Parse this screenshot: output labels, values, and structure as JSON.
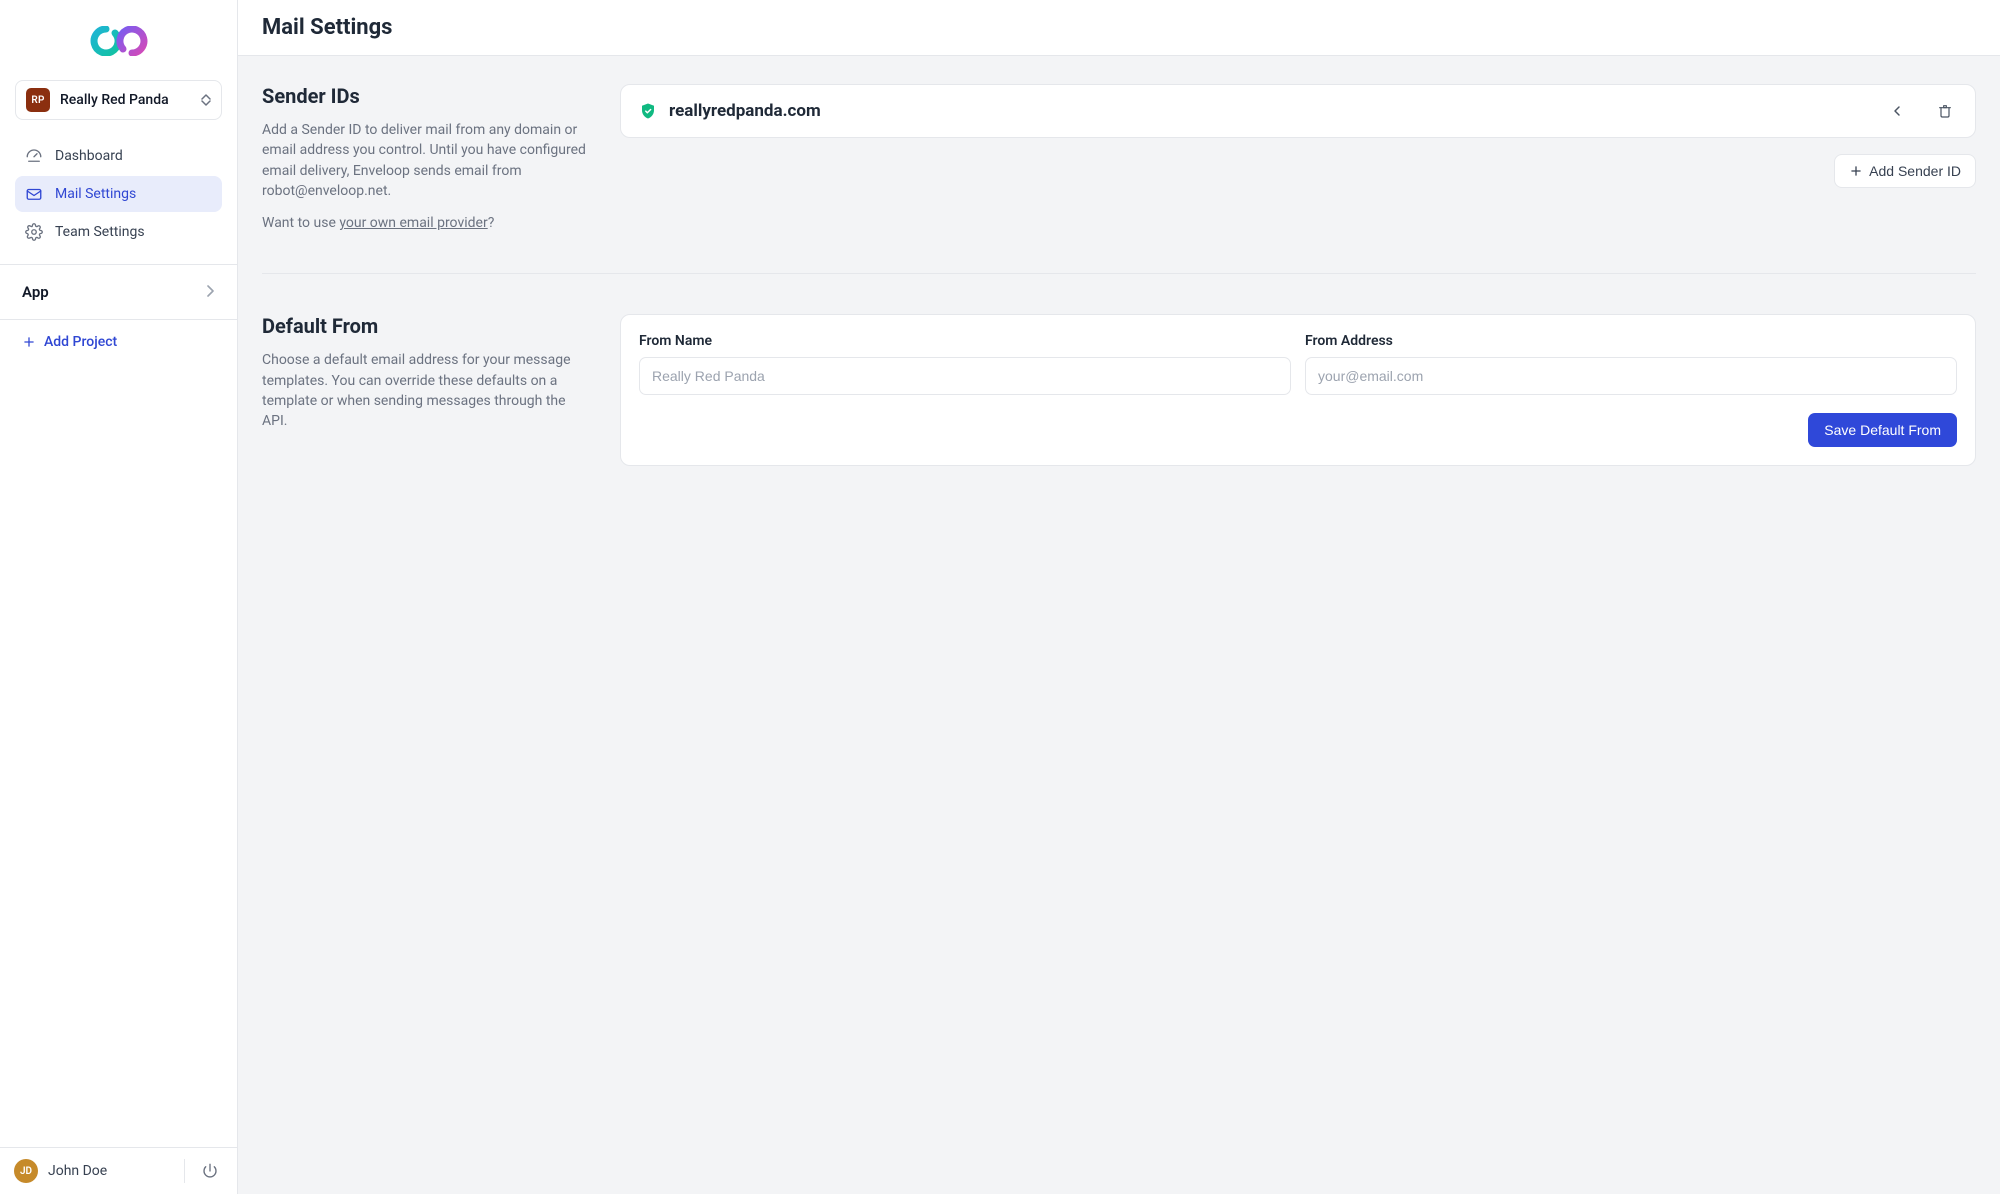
{
  "sidebar": {
    "project": {
      "initials": "RP",
      "name": "Really Red Panda"
    },
    "nav": {
      "dashboard": "Dashboard",
      "mail_settings": "Mail Settings",
      "team_settings": "Team Settings"
    },
    "app_section_label": "App",
    "add_project_label": "Add Project"
  },
  "user": {
    "initials": "JD",
    "name": "John Doe"
  },
  "header": {
    "title": "Mail Settings"
  },
  "sender_ids": {
    "title": "Sender IDs",
    "description": "Add a Sender ID to deliver mail from any domain or email address you control. Until you have configured email delivery, Enveloop sends email from robot@enveloop.net.",
    "provider_prompt_prefix": "Want to use ",
    "provider_prompt_link": "your own email provider",
    "provider_prompt_suffix": "?",
    "items": [
      {
        "domain": "reallyredpanda.com"
      }
    ],
    "add_button": "Add Sender ID"
  },
  "default_from": {
    "title": "Default From",
    "description": "Choose a default email address for your message templates. You can override these defaults on a template or when sending messages through the API.",
    "from_name_label": "From Name",
    "from_name_placeholder": "Really Red Panda",
    "from_address_label": "From Address",
    "from_address_placeholder": "your@email.com",
    "save_button": "Save Default From"
  }
}
